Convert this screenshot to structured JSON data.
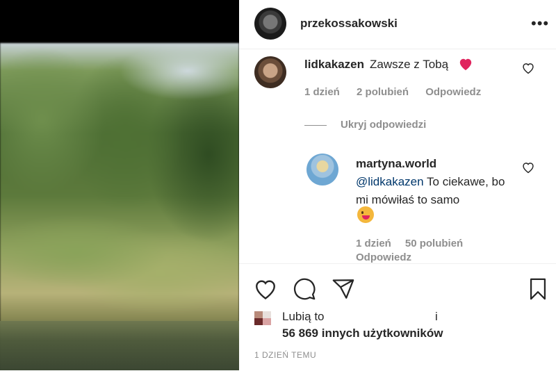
{
  "post": {
    "author": "przekossakowski",
    "more_label": "•••"
  },
  "comment": {
    "user": "lidkakazen",
    "text": "Zawsze z Tobą",
    "emoji": "heart",
    "age": "1 dzień",
    "likes": "2 polubień",
    "reply_label": "Odpowiedz",
    "hide_replies": "Ukryj odpowiedzi"
  },
  "reply": {
    "user": "martyna.world",
    "mention": "@lidkakazen",
    "text": "To ciekawe, bo mi mówiłaś to samo",
    "emoji": "tongue-face",
    "age": "1 dzień",
    "likes": "50 polubień",
    "reply_label": "Odpowiedz"
  },
  "actions": {
    "liked_by_prefix": "Lubią to",
    "liked_by_extra": "i",
    "liked_count": "56 869 innych użytkowników",
    "date": "1 DZIEŃ TEMU"
  },
  "colors": {
    "text": "#262626",
    "meta": "#8e8e8e",
    "mention": "#00376b",
    "heart": "#e0245e"
  },
  "icons": [
    "heart-icon",
    "comment-icon",
    "share-icon",
    "bookmark-icon",
    "more-icon"
  ]
}
